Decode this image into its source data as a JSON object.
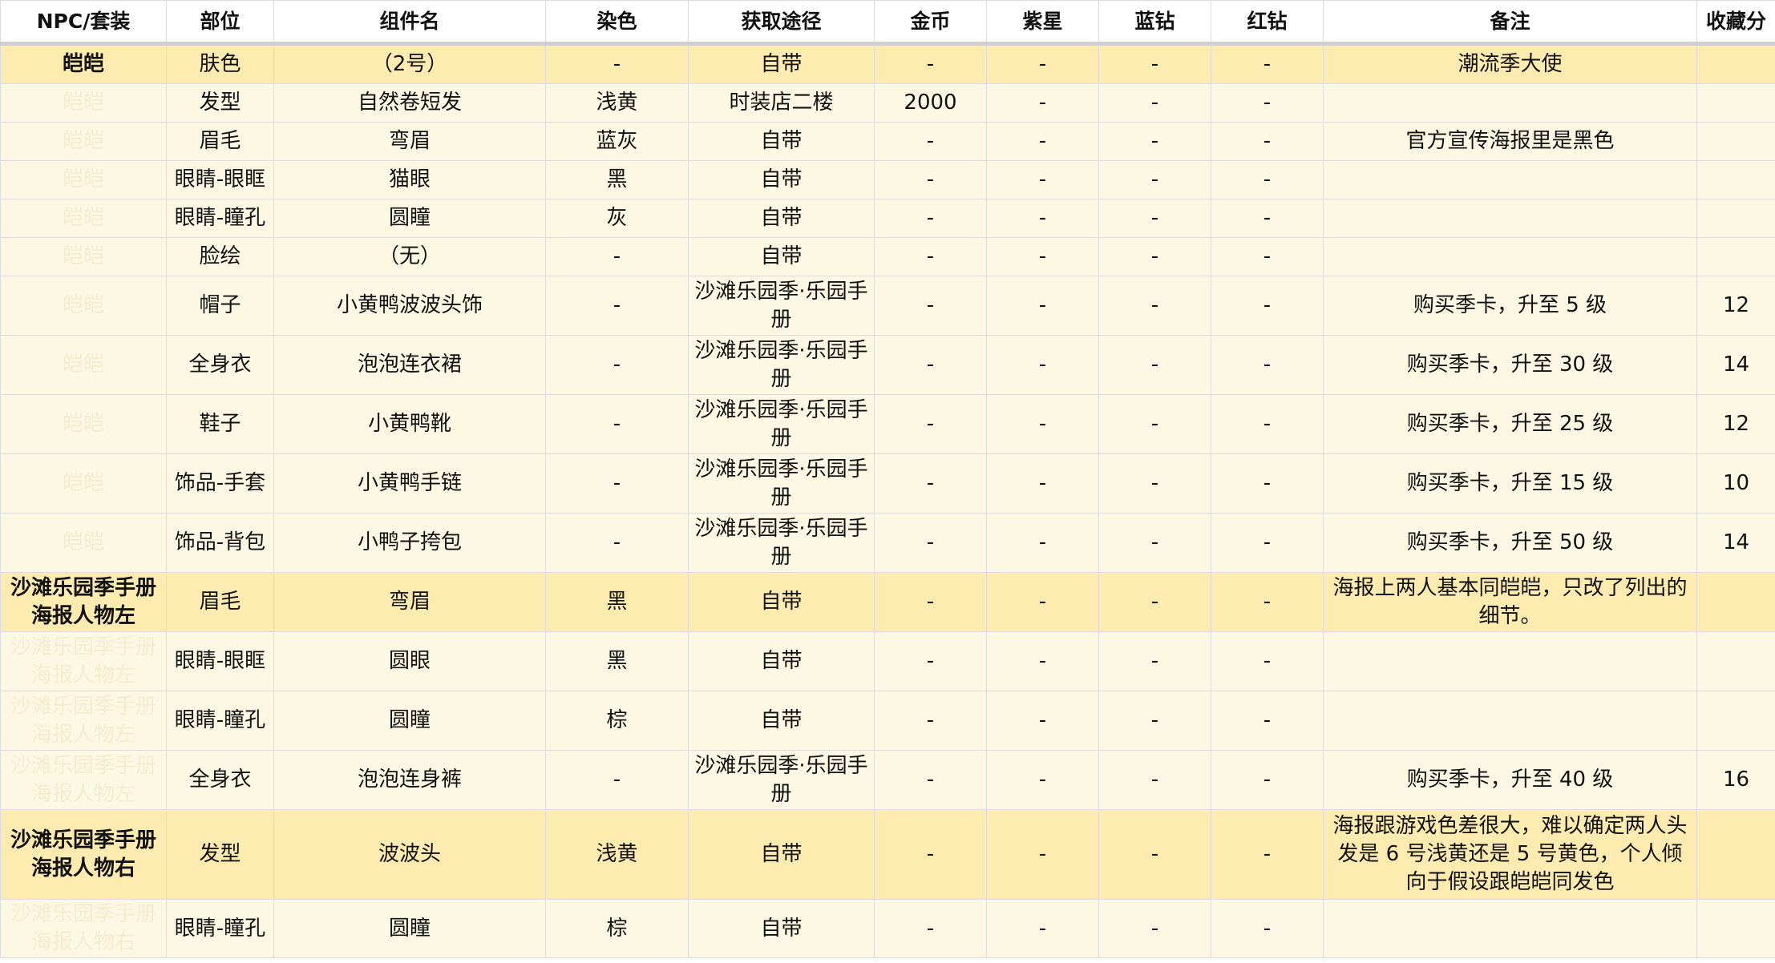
{
  "table": {
    "headers": [
      "NPC/套装",
      "部位",
      "组件名",
      "染色",
      "获取途径",
      "金币",
      "紫星",
      "蓝钻",
      "红钻",
      "备注",
      "收藏分"
    ],
    "rows": [
      {
        "group": true,
        "npc": "皑皑",
        "part": "肤色",
        "name": "（2号）",
        "dye": "-",
        "source": "自带",
        "gold": "-",
        "purple": "-",
        "blue": "-",
        "red": "-",
        "note": "潮流季大使",
        "score": ""
      },
      {
        "group": false,
        "npc": "皑皑",
        "part": "发型",
        "name": "自然卷短发",
        "dye": "浅黄",
        "source": "时装店二楼",
        "gold": "2000",
        "purple": "-",
        "blue": "-",
        "red": "-",
        "note": "",
        "score": ""
      },
      {
        "group": false,
        "npc": "皑皑",
        "part": "眉毛",
        "name": "弯眉",
        "dye": "蓝灰",
        "source": "自带",
        "gold": "-",
        "purple": "-",
        "blue": "-",
        "red": "-",
        "note": "官方宣传海报里是黑色",
        "score": ""
      },
      {
        "group": false,
        "npc": "皑皑",
        "part": "眼睛-眼眶",
        "name": "猫眼",
        "dye": "黑",
        "source": "自带",
        "gold": "-",
        "purple": "-",
        "blue": "-",
        "red": "-",
        "note": "",
        "score": ""
      },
      {
        "group": false,
        "npc": "皑皑",
        "part": "眼睛-瞳孔",
        "name": "圆瞳",
        "dye": "灰",
        "source": "自带",
        "gold": "-",
        "purple": "-",
        "blue": "-",
        "red": "-",
        "note": "",
        "score": ""
      },
      {
        "group": false,
        "npc": "皑皑",
        "part": "脸绘",
        "name": "（无）",
        "dye": "-",
        "source": "自带",
        "gold": "-",
        "purple": "-",
        "blue": "-",
        "red": "-",
        "note": "",
        "score": ""
      },
      {
        "group": false,
        "npc": "皑皑",
        "part": "帽子",
        "name": "小黄鸭波波头饰",
        "dye": "-",
        "source": "沙滩乐园季·乐园手册",
        "gold": "-",
        "purple": "-",
        "blue": "-",
        "red": "-",
        "note": "购买季卡，升至 5 级",
        "score": "12"
      },
      {
        "group": false,
        "npc": "皑皑",
        "part": "全身衣",
        "name": "泡泡连衣裙",
        "dye": "-",
        "source": "沙滩乐园季·乐园手册",
        "gold": "-",
        "purple": "-",
        "blue": "-",
        "red": "-",
        "note": "购买季卡，升至 30 级",
        "score": "14"
      },
      {
        "group": false,
        "npc": "皑皑",
        "part": "鞋子",
        "name": "小黄鸭靴",
        "dye": "-",
        "source": "沙滩乐园季·乐园手册",
        "gold": "-",
        "purple": "-",
        "blue": "-",
        "red": "-",
        "note": "购买季卡，升至 25 级",
        "score": "12"
      },
      {
        "group": false,
        "npc": "皑皑",
        "part": "饰品-手套",
        "name": "小黄鸭手链",
        "dye": "-",
        "source": "沙滩乐园季·乐园手册",
        "gold": "-",
        "purple": "-",
        "blue": "-",
        "red": "-",
        "note": "购买季卡，升至 15 级",
        "score": "10"
      },
      {
        "group": false,
        "npc": "皑皑",
        "part": "饰品-背包",
        "name": "小鸭子挎包",
        "dye": "-",
        "source": "沙滩乐园季·乐园手册",
        "gold": "-",
        "purple": "-",
        "blue": "-",
        "red": "-",
        "note": "购买季卡，升至 50 级",
        "score": "14"
      },
      {
        "group": true,
        "npc": "沙滩乐园季手册海报人物左",
        "part": "眉毛",
        "name": "弯眉",
        "dye": "黑",
        "source": "自带",
        "gold": "-",
        "purple": "-",
        "blue": "-",
        "red": "-",
        "note": "海报上两人基本同皑皑，只改了列出的细节。",
        "score": ""
      },
      {
        "group": false,
        "npc": "沙滩乐园季手册海报人物左",
        "part": "眼睛-眼眶",
        "name": "圆眼",
        "dye": "黑",
        "source": "自带",
        "gold": "-",
        "purple": "-",
        "blue": "-",
        "red": "-",
        "note": "",
        "score": ""
      },
      {
        "group": false,
        "npc": "沙滩乐园季手册海报人物左",
        "part": "眼睛-瞳孔",
        "name": "圆瞳",
        "dye": "棕",
        "source": "自带",
        "gold": "-",
        "purple": "-",
        "blue": "-",
        "red": "-",
        "note": "",
        "score": ""
      },
      {
        "group": false,
        "npc": "沙滩乐园季手册海报人物左",
        "part": "全身衣",
        "name": "泡泡连身裤",
        "dye": "-",
        "source": "沙滩乐园季·乐园手册",
        "gold": "-",
        "purple": "-",
        "blue": "-",
        "red": "-",
        "note": "购买季卡，升至 40 级",
        "score": "16"
      },
      {
        "group": true,
        "npc": "沙滩乐园季手册海报人物右",
        "part": "发型",
        "name": "波波头",
        "dye": "浅黄",
        "source": "自带",
        "gold": "-",
        "purple": "-",
        "blue": "-",
        "red": "-",
        "note": "海报跟游戏色差很大，难以确定两人头发是 6 号浅黄还是 5 号黄色，个人倾向于假设跟皑皑同发色",
        "score": ""
      },
      {
        "group": false,
        "npc": "沙滩乐园季手册海报人物右",
        "part": "眼睛-瞳孔",
        "name": "圆瞳",
        "dye": "棕",
        "source": "自带",
        "gold": "-",
        "purple": "-",
        "blue": "-",
        "red": "-",
        "note": "",
        "score": ""
      }
    ]
  }
}
